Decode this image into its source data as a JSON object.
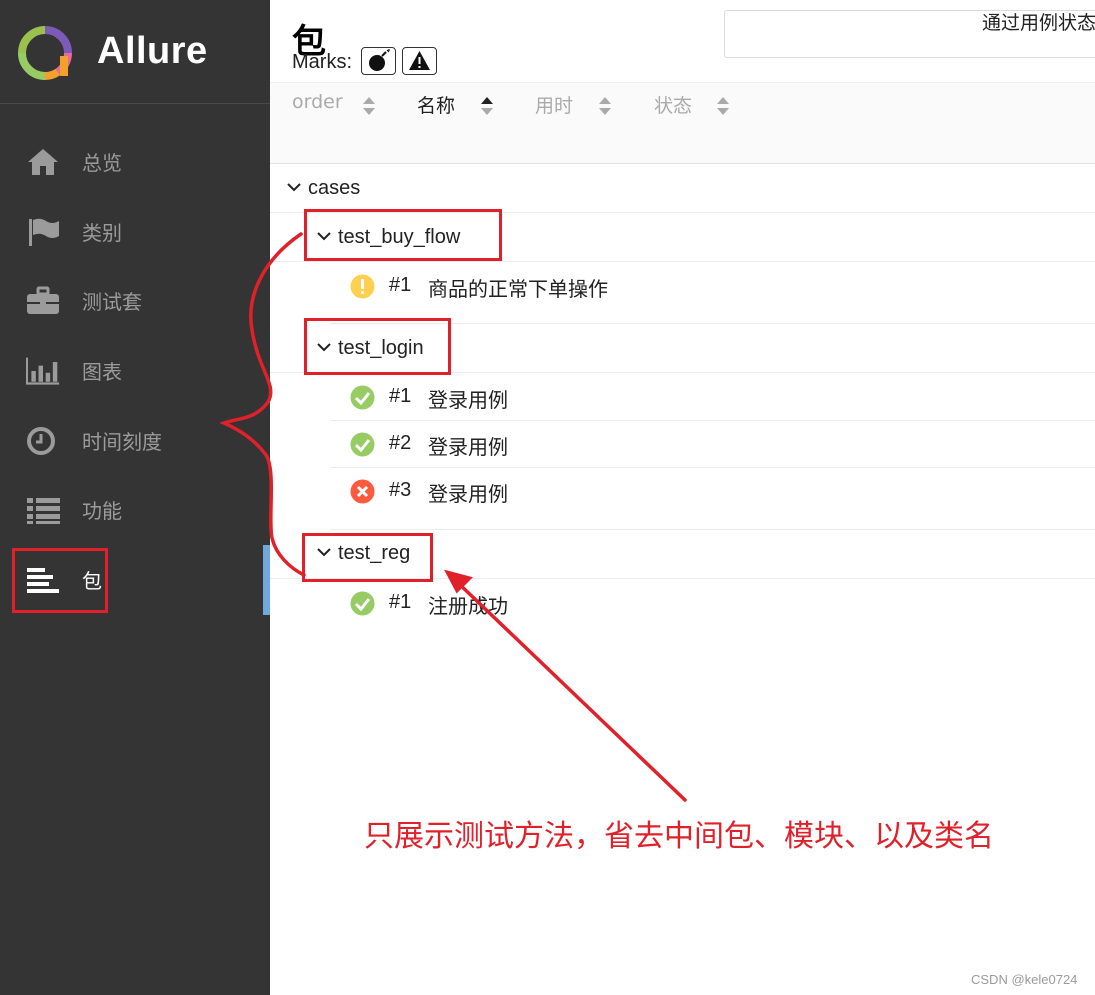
{
  "brand": {
    "name": "Allure",
    "logo_icon": "allure-logo-icon"
  },
  "sidebar": {
    "items": [
      {
        "label": "总览",
        "icon": "home-icon"
      },
      {
        "label": "类别",
        "icon": "flag-icon"
      },
      {
        "label": "测试套",
        "icon": "briefcase-icon"
      },
      {
        "label": "图表",
        "icon": "bar-chart-icon"
      },
      {
        "label": "时间刻度",
        "icon": "clock-icon"
      },
      {
        "label": "功能",
        "icon": "list-icon"
      },
      {
        "label": "包",
        "icon": "packages-icon",
        "active": true
      }
    ],
    "active_color": "#6fa8dc"
  },
  "header": {
    "title": "包"
  },
  "toolbar": {
    "sort_columns": [
      {
        "label": "order",
        "active": false
      },
      {
        "label": "名称",
        "active": true
      },
      {
        "label": "用时",
        "active": false
      },
      {
        "label": "状态",
        "active": false
      }
    ],
    "right_label": "通过用例状态",
    "marks_label": "Marks:",
    "mark_buttons": [
      "bomb-icon",
      "warning-icon"
    ]
  },
  "tree": {
    "root": {
      "label": "cases"
    },
    "groups": [
      {
        "label": "test_buy_flow",
        "children": [
          {
            "num": "#1",
            "name": "商品的正常下单操作",
            "status": "broken"
          }
        ]
      },
      {
        "label": "test_login",
        "children": [
          {
            "num": "#1",
            "name": "登录用例",
            "status": "passed"
          },
          {
            "num": "#2",
            "name": "登录用例",
            "status": "passed"
          },
          {
            "num": "#3",
            "name": "登录用例",
            "status": "failed"
          }
        ]
      },
      {
        "label": "test_reg",
        "children": [
          {
            "num": "#1",
            "name": "注册成功",
            "status": "passed"
          }
        ]
      }
    ]
  },
  "annotation": {
    "text": "只展示测试方法，省去中间包、模块、以及类名",
    "color": "#e0212a"
  },
  "status_colors": {
    "passed": "#97cc64",
    "failed": "#fd5a3e",
    "broken": "#ffd050"
  },
  "watermark": "CSDN @kele0724"
}
